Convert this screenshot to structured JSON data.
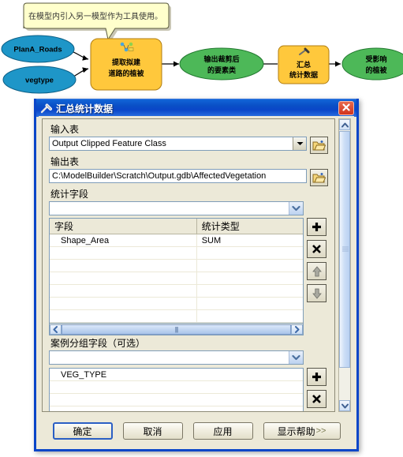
{
  "flowchart": {
    "callout": {
      "text": "在模型内引入另一模型作为工具使用。"
    },
    "nodes": [
      {
        "id": "plana-roads",
        "label": "PlanA_Roads",
        "shape": "ellipse",
        "color": "#1e96c8"
      },
      {
        "id": "vegtype",
        "label": "vegtype",
        "shape": "ellipse",
        "color": "#1e96c8"
      },
      {
        "id": "extract-veg",
        "label_line1": "提取拟建",
        "label_line2": "道路的植被",
        "shape": "rounded-rect",
        "color": "#ffc83c"
      },
      {
        "id": "clipped-output",
        "label_line1": "输出裁剪后",
        "label_line2": "的要素类",
        "shape": "ellipse",
        "color": "#4db858"
      },
      {
        "id": "summary-stats",
        "label_line1": "汇总",
        "label_line2": "统计数据",
        "shape": "rounded-rect",
        "color": "#ffc83c"
      },
      {
        "id": "affected-veg",
        "label_line1": "受影响",
        "label_line2": "的植被",
        "shape": "ellipse",
        "color": "#4db858"
      }
    ]
  },
  "dialog": {
    "title": "汇总统计数据",
    "close_tooltip": "关闭",
    "input_table": {
      "label": "输入表",
      "value": "Output Clipped Feature Class",
      "browse_label": "浏览"
    },
    "output_table": {
      "label": "输出表",
      "value": "C:\\ModelBuilder\\Scratch\\Output.gdb\\AffectedVegetation",
      "browse_label": "浏览"
    },
    "statistics_field": {
      "label": "统计字段",
      "value": ""
    },
    "stats_grid": {
      "columns": [
        "字段",
        "统计类型"
      ],
      "rows": [
        {
          "field": "Shape_Area",
          "stat": "SUM"
        },
        {
          "field": "",
          "stat": ""
        },
        {
          "field": "",
          "stat": ""
        },
        {
          "field": "",
          "stat": ""
        },
        {
          "field": "",
          "stat": ""
        },
        {
          "field": "",
          "stat": ""
        },
        {
          "field": "",
          "stat": ""
        }
      ],
      "buttons": {
        "add": "+",
        "remove": "×",
        "up": "↑",
        "down": "↓"
      }
    },
    "case_field": {
      "label": "案例分组字段（可选）",
      "value": ""
    },
    "case_grid": {
      "rows": [
        {
          "field": "VEG_TYPE"
        },
        {
          "field": ""
        },
        {
          "field": ""
        },
        {
          "field": ""
        }
      ],
      "buttons": {
        "add": "+",
        "remove": "×"
      }
    },
    "buttons": {
      "ok": "确定",
      "cancel": "取消",
      "apply": "应用",
      "help": "显示帮助",
      "help_arrows": ">>"
    }
  },
  "colors": {
    "title_blue": "#0a46c8",
    "dialog_face": "#ece9d8",
    "node_orange": "#ffc83c",
    "node_green": "#4db858",
    "node_blue": "#1e96c8",
    "callout_yellow": "#ffffcc"
  }
}
